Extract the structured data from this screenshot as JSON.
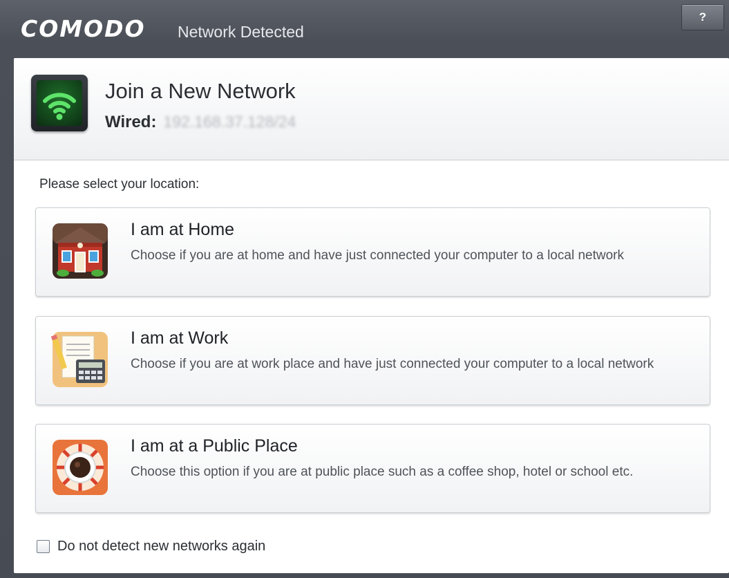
{
  "window": {
    "brand": "COMODO",
    "title": "Network Detected",
    "help_label": "?"
  },
  "header": {
    "title": "Join a New Network",
    "connection_label": "Wired:",
    "connection_value": "192.168.37.128/24",
    "icon": "wifi-icon"
  },
  "prompt": "Please select your location:",
  "options": [
    {
      "title": "I am at Home",
      "description": "Choose if you are at home and have just connected your computer to a local network",
      "icon": "house-icon"
    },
    {
      "title": "I am at Work",
      "description": "Choose if you are at work place and have just connected your computer to a local network",
      "icon": "office-icon"
    },
    {
      "title": "I am at a Public Place",
      "description": "Choose this option if you are at public place such as a coffee shop, hotel or school etc.",
      "icon": "coffee-icon"
    }
  ],
  "footer": {
    "checkbox_label": "Do not detect new networks again",
    "checked": false
  },
  "colors": {
    "titlebar": "#4b4f57",
    "wifi_green": "#5ee36a",
    "text": "#2b2f33"
  }
}
